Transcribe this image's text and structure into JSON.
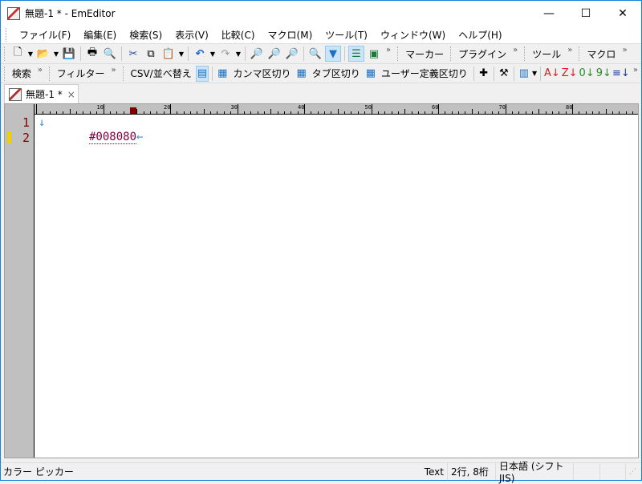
{
  "window": {
    "title": "無題-1 * - EmEditor",
    "minimize": "—",
    "maximize": "☐",
    "close": "✕"
  },
  "menu": [
    "ファイル(F)",
    "編集(E)",
    "検索(S)",
    "表示(V)",
    "比較(C)",
    "マクロ(M)",
    "ツール(T)",
    "ウィンドウ(W)",
    "ヘルプ(H)"
  ],
  "toolbar": {
    "marker": "マーカー",
    "plugin": "プラグイン",
    "tools": "ツール",
    "macro": "マクロ",
    "chevron": "»"
  },
  "toolbar2": {
    "search": "検索",
    "filter": "フィルター",
    "csv": "CSV/並べ替え",
    "comma": "カンマ区切り",
    "tab": "タブ区切り",
    "user": "ユーザー定義区切り"
  },
  "tab": {
    "label": "無題-1 *",
    "close": "×"
  },
  "ruler": [
    "10",
    "20",
    "30",
    "40",
    "50",
    "60",
    "70",
    "80"
  ],
  "editor": {
    "lines": [
      "1",
      "2"
    ],
    "line1_mark": "↓",
    "line2_text": "#008080",
    "line2_mark": "←"
  },
  "status": {
    "left": "カラー ピッカー",
    "mode": "Text",
    "position": "2行, 8桁",
    "encoding": "日本語 (シフト JIS)"
  },
  "colors": {
    "accent": "#1883d7",
    "text_color_code": "#800040",
    "line_number": "#800000"
  }
}
